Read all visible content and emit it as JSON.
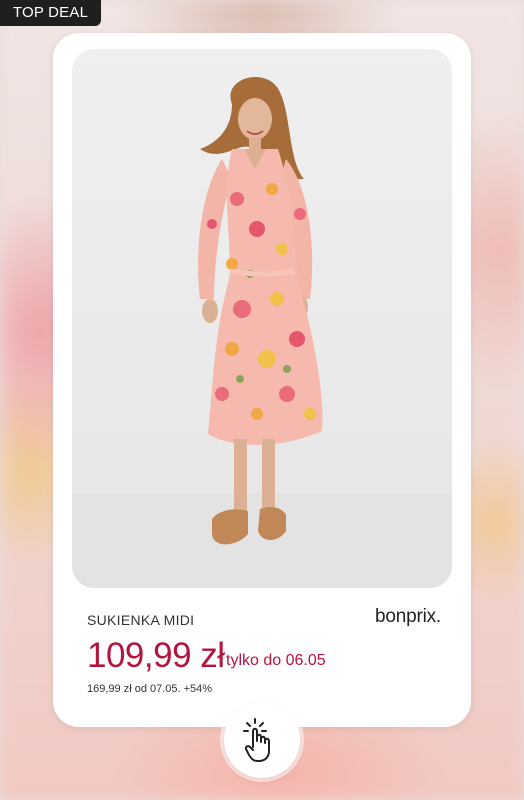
{
  "badge": {
    "label": "TOP DEAL"
  },
  "product": {
    "name": "SUKIENKA MIDI",
    "brand": "bonprix.",
    "price": "109,99 zł",
    "promo": "tylko do 06.05",
    "old_price_note": "169,99 zł od 07.05. +54%"
  },
  "colors": {
    "price": "#b3153f",
    "badge_bg": "#1f1f1f"
  },
  "icons": {
    "cta": "tap-hand-icon"
  }
}
